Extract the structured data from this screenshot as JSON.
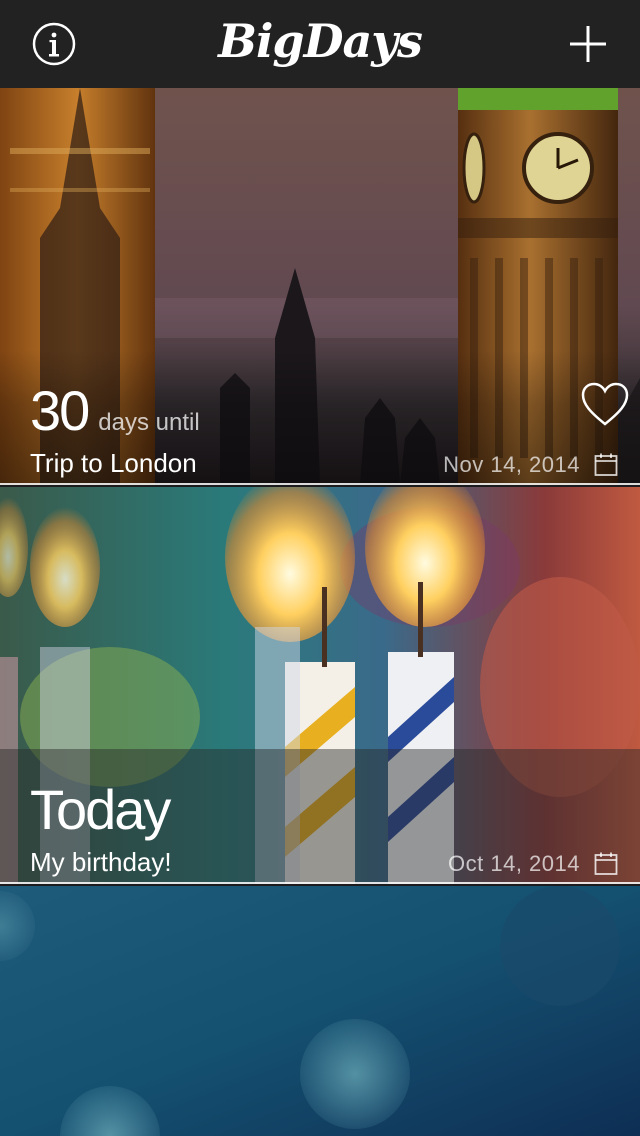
{
  "header": {
    "title": "BigDays",
    "info_icon": "info-circle-icon",
    "add_icon": "plus-icon"
  },
  "events": [
    {
      "count": "30",
      "unit": "days until",
      "title": "Trip to London",
      "date": "Nov 14, 2014",
      "favorite_icon": "heart-outline-icon",
      "calendar_icon": "calendar-icon"
    },
    {
      "count": "Today",
      "unit": "",
      "title": "My birthday!",
      "date": "Oct 14, 2014",
      "calendar_icon": "calendar-icon"
    }
  ],
  "colors": {
    "header_bg": "#222222",
    "text": "#ffffff"
  }
}
